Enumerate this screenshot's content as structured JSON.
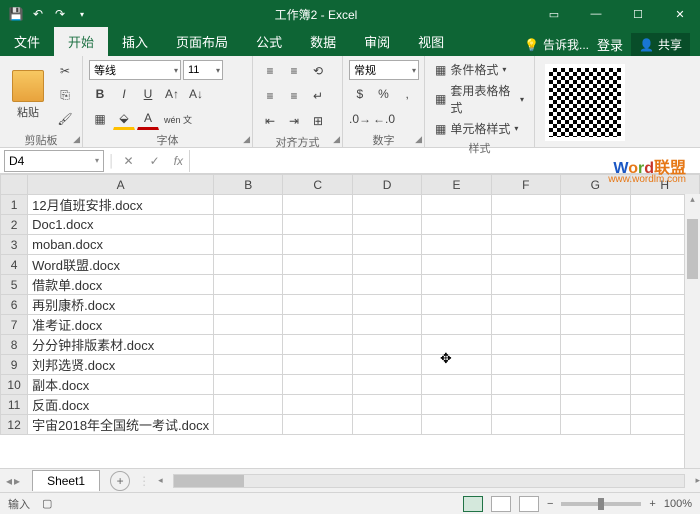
{
  "titlebar": {
    "title": "工作簿2 - Excel"
  },
  "tabs": {
    "file": "文件",
    "home": "开始",
    "insert": "插入",
    "layout": "页面布局",
    "formulas": "公式",
    "data": "数据",
    "review": "审阅",
    "view": "视图",
    "tellme": "告诉我...",
    "login": "登录",
    "share": "共享"
  },
  "ribbon": {
    "clipboard": {
      "label": "剪贴板",
      "paste": "粘贴"
    },
    "font": {
      "label": "字体",
      "name": "等线",
      "size": "11",
      "wen": "wén 文"
    },
    "alignment": {
      "label": "对齐方式",
      "general": "常规"
    },
    "number": {
      "label": "数字"
    },
    "styles": {
      "label": "样式",
      "cond": "条件格式",
      "table": "套用表格格式",
      "cell": "单元格样式"
    }
  },
  "formula_bar": {
    "cell_ref": "D4",
    "fx": "fx"
  },
  "columns": [
    "A",
    "B",
    "C",
    "D",
    "E",
    "F",
    "G",
    "H"
  ],
  "rows": [
    {
      "n": "1",
      "a": "12月值班安排.docx"
    },
    {
      "n": "2",
      "a": "Doc1.docx"
    },
    {
      "n": "3",
      "a": "moban.docx"
    },
    {
      "n": "4",
      "a": "Word联盟.docx"
    },
    {
      "n": "5",
      "a": "借款单.docx"
    },
    {
      "n": "6",
      "a": "再别康桥.docx"
    },
    {
      "n": "7",
      "a": "准考证.docx"
    },
    {
      "n": "8",
      "a": "分分钟排版素材.docx"
    },
    {
      "n": "9",
      "a": "刘邦选贤.docx"
    },
    {
      "n": "10",
      "a": "副本.docx"
    },
    {
      "n": "11",
      "a": "反面.docx"
    },
    {
      "n": "12",
      "a": "宇宙2018年全国统一考试.docx"
    }
  ],
  "sheet": {
    "name": "Sheet1"
  },
  "status": {
    "mode": "输入",
    "zoom": "100%"
  },
  "watermark": {
    "brand_cn": "联盟",
    "url": "www.wordlm.com"
  }
}
